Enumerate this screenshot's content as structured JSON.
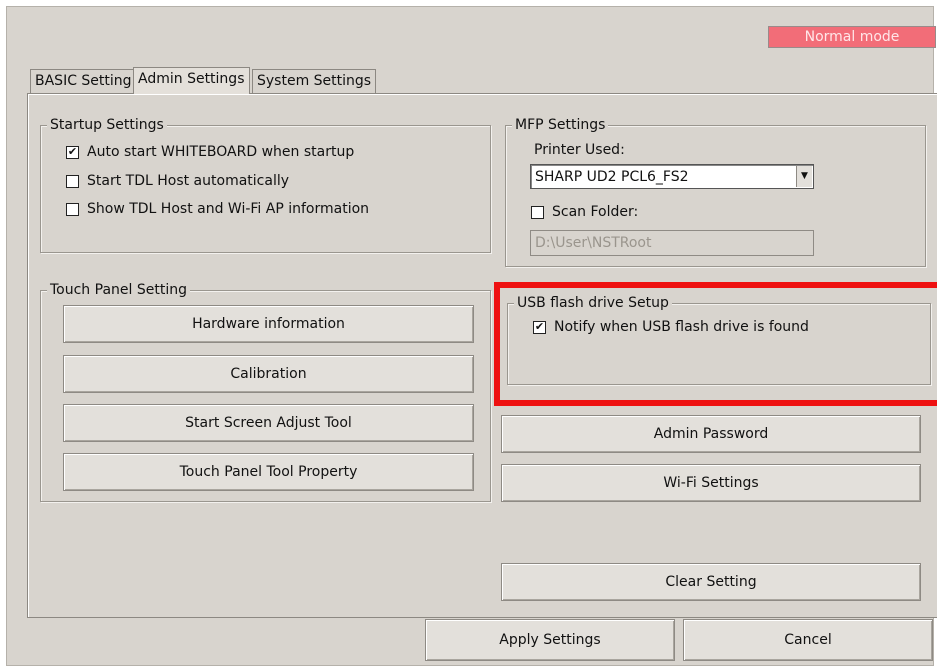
{
  "mode_badge": "Normal mode",
  "tabs": [
    {
      "label": "BASIC Setting"
    },
    {
      "label": "Admin Settings"
    },
    {
      "label": "System Settings"
    }
  ],
  "startup": {
    "legend": "Startup Settings",
    "items": [
      {
        "label": "Auto start WHITEBOARD when startup",
        "checked": true
      },
      {
        "label": "Start TDL Host automatically",
        "checked": false
      },
      {
        "label": "Show TDL Host and Wi-Fi AP information",
        "checked": false
      }
    ]
  },
  "touch_panel": {
    "legend": "Touch Panel Setting",
    "buttons": [
      {
        "label": "Hardware information"
      },
      {
        "label": "Calibration"
      },
      {
        "label": "Start Screen Adjust Tool"
      },
      {
        "label": "Touch Panel Tool Property"
      }
    ]
  },
  "mfp": {
    "legend": "MFP Settings",
    "printer_label": "Printer Used:",
    "printer_value": "SHARP UD2 PCL6_FS2",
    "scan_folder_label": "Scan Folder:",
    "scan_folder_checked": false,
    "scan_folder_path": "D:\\User\\NSTRoot"
  },
  "usb": {
    "legend": "USB flash drive Setup",
    "notify_label": "Notify when USB flash drive is found",
    "notify_checked": true
  },
  "right_buttons": {
    "admin_password": "Admin Password",
    "wifi_settings": "Wi-Fi Settings",
    "clear_setting": "Clear Setting"
  },
  "footer": {
    "apply": "Apply Settings",
    "cancel": "Cancel"
  },
  "icons": {
    "check": "✔",
    "dropdown": "▼"
  },
  "colors": {
    "mode_badge_bg": "#f26d78",
    "highlight": "#ee1111",
    "window_bg": "#d8d4ce"
  }
}
